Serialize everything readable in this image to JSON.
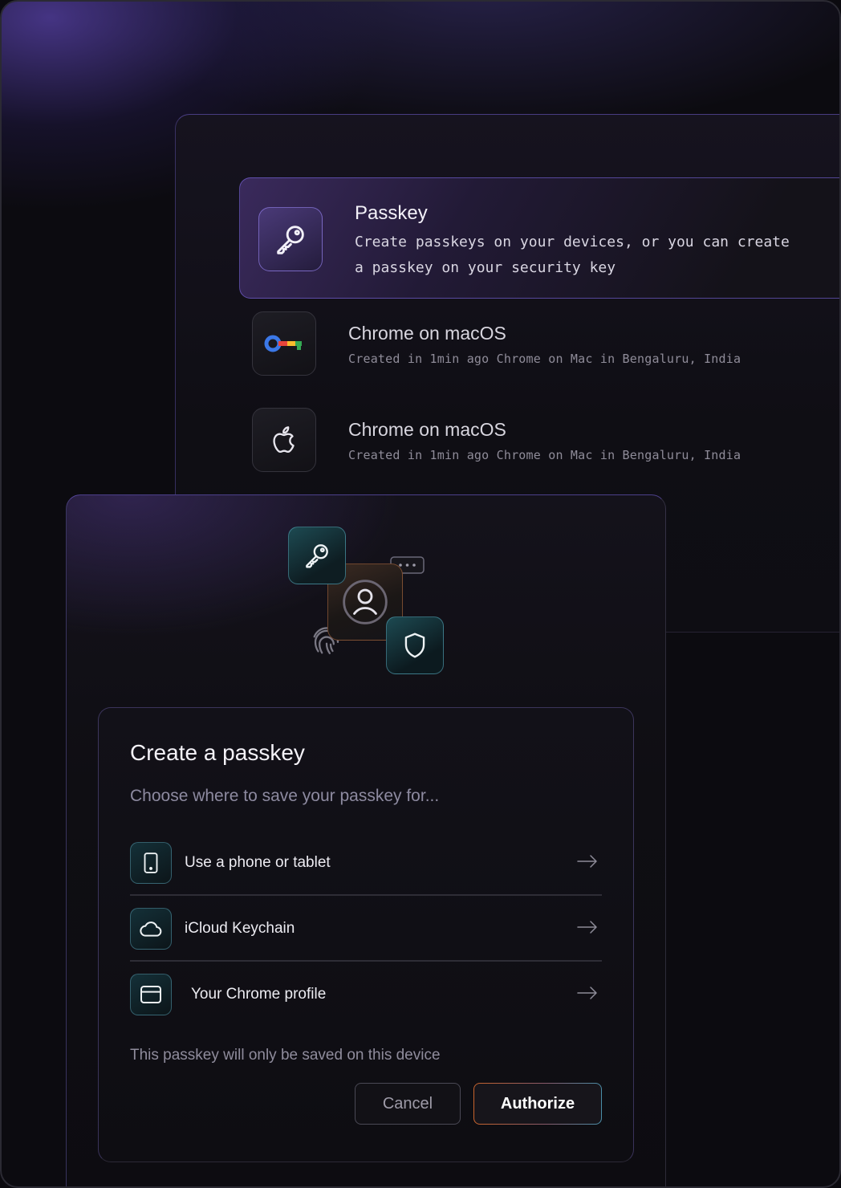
{
  "passkey_card": {
    "title": "Passkey",
    "description": "Create passkeys on your devices, or you can create a passkey on your security key",
    "icon": "key-icon"
  },
  "saved_passkeys": [
    {
      "title": "Chrome on macOS",
      "subtitle": "Created in 1min ago Chrome on Mac in Bengaluru, India",
      "icon": "google-password-manager-icon"
    },
    {
      "title": "Chrome on macOS",
      "subtitle": "Created in 1min ago Chrome on Mac in Bengaluru, India",
      "icon": "apple-icon"
    }
  ],
  "illustration": {
    "icons": [
      "key-icon",
      "user-icon",
      "shield-icon",
      "password-dots-icon",
      "fingerprint-icon"
    ]
  },
  "dialog": {
    "title": "Create a passkey",
    "subtitle": "Choose where to save your passkey for...",
    "options": [
      {
        "label": "Use a phone or tablet",
        "icon": "phone-icon"
      },
      {
        "label": "iCloud Keychain",
        "icon": "cloud-icon"
      },
      {
        "label": "Your Chrome profile",
        "icon": "browser-window-icon"
      }
    ],
    "note": "This passkey will only be saved on this device",
    "cancel_label": "Cancel",
    "authorize_label": "Authorize"
  },
  "colors": {
    "accent_purple": "#7d69e6",
    "accent_teal": "#5aa0b4",
    "accent_orange": "#c8642c",
    "background": "#0c0b10"
  }
}
